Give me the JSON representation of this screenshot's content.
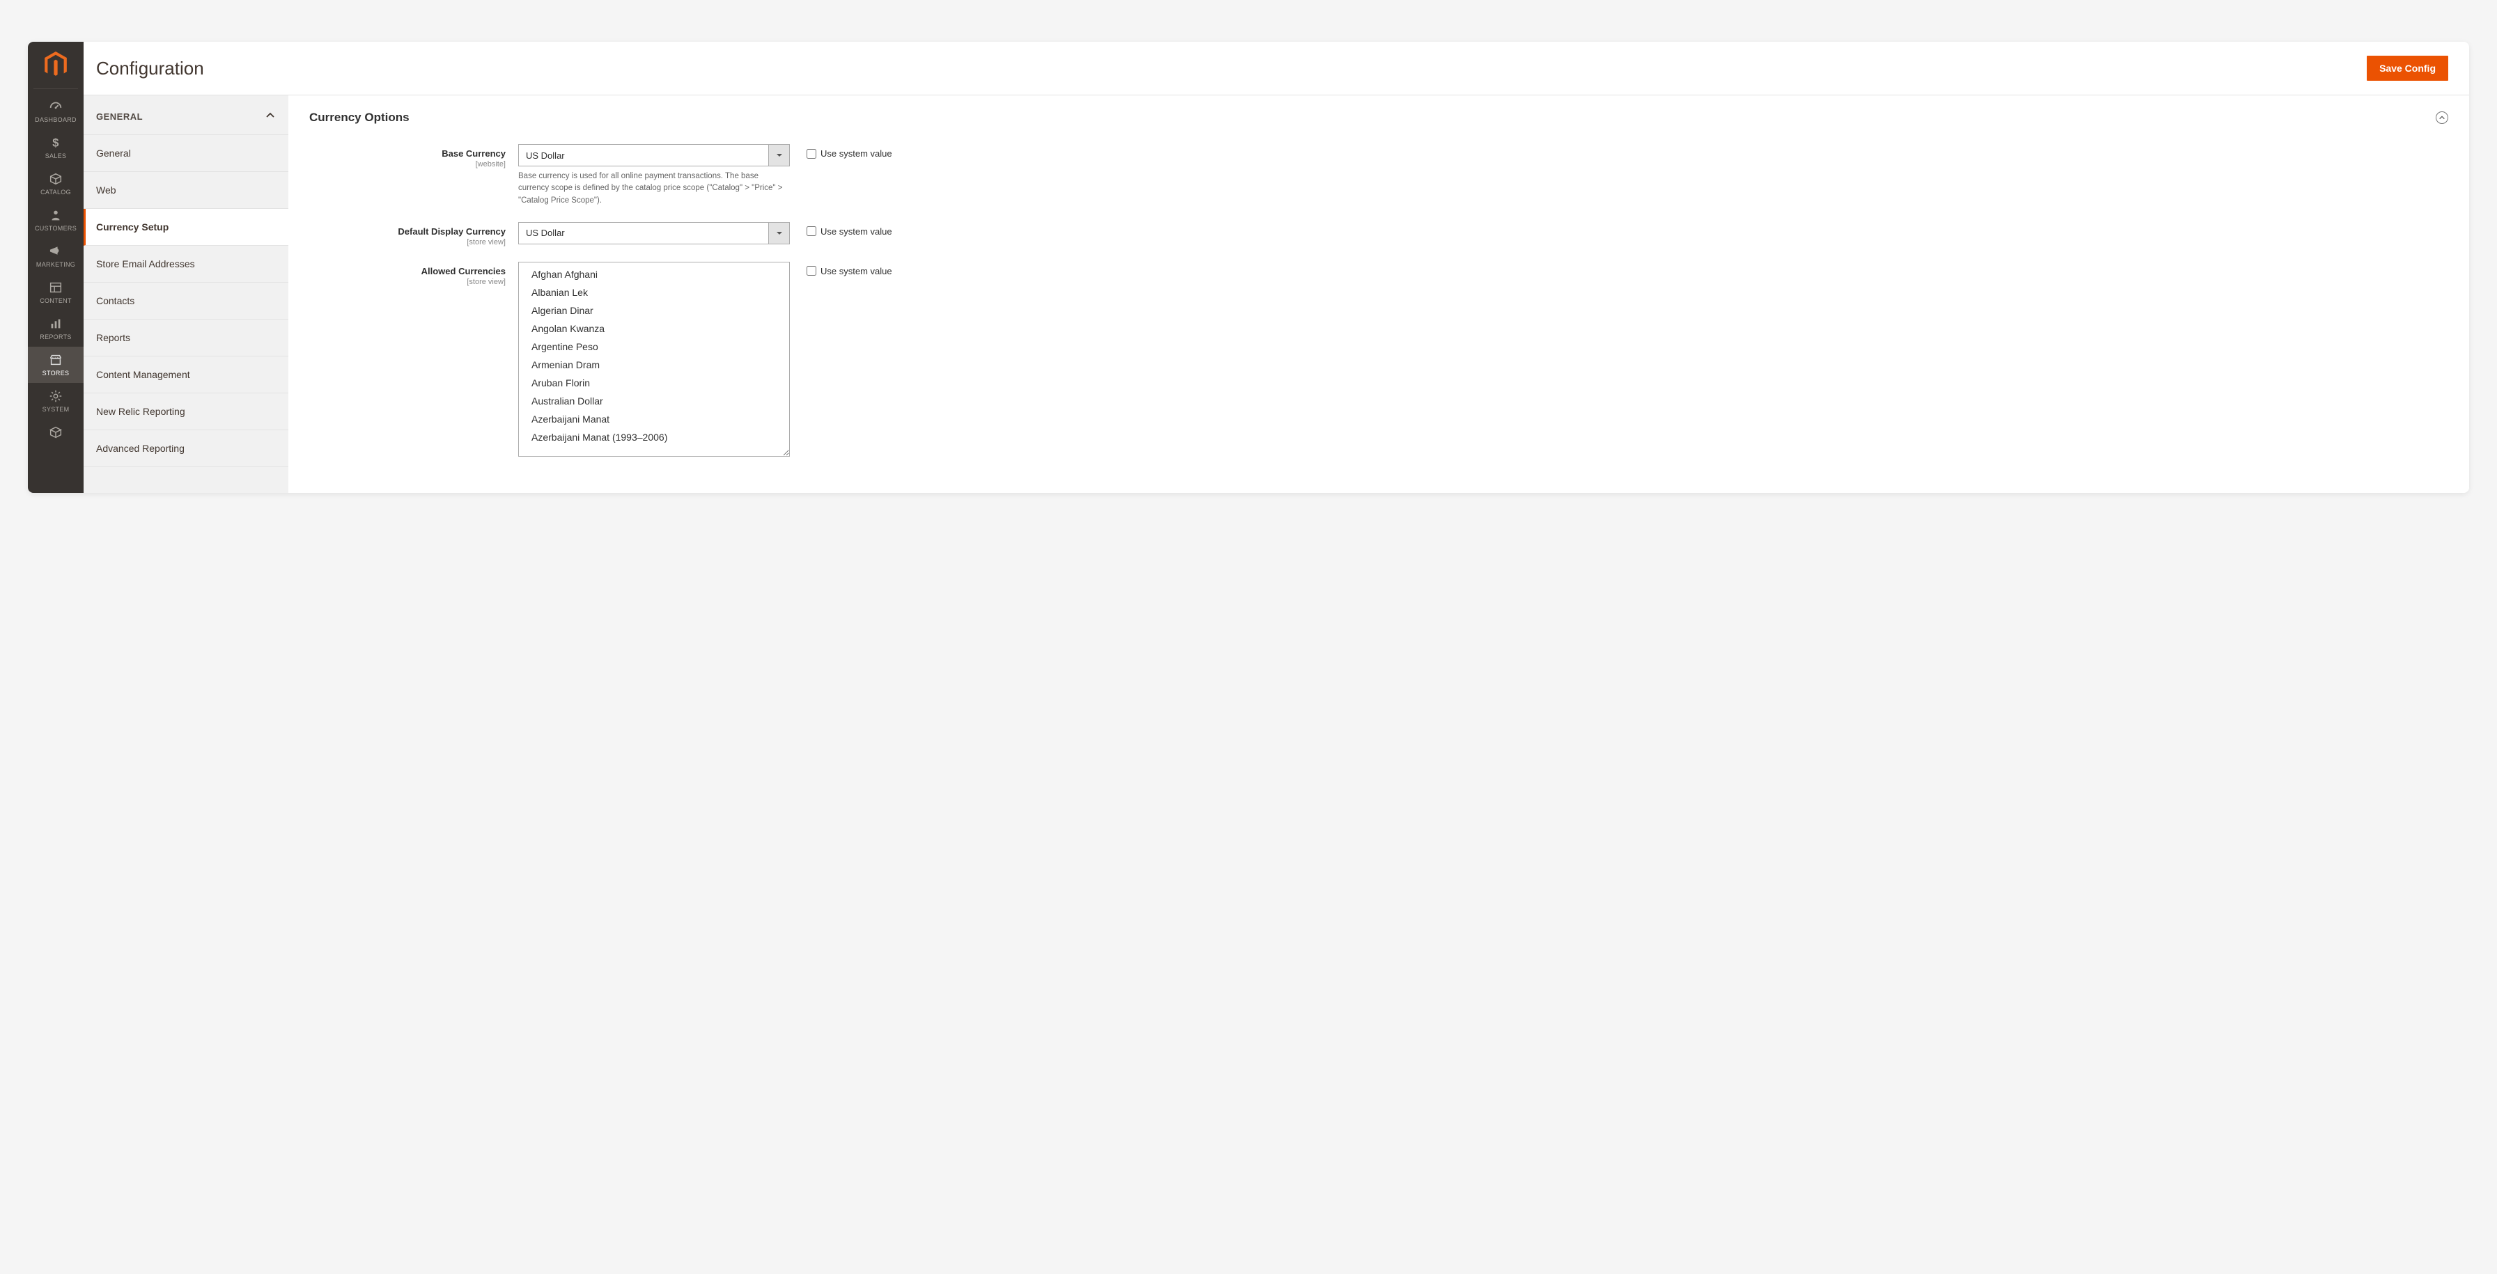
{
  "header": {
    "title": "Configuration",
    "save_button": "Save Config"
  },
  "nav": {
    "items": [
      {
        "id": "dashboard",
        "label": "DASHBOARD",
        "icon": "dashboard"
      },
      {
        "id": "sales",
        "label": "SALES",
        "icon": "dollar"
      },
      {
        "id": "catalog",
        "label": "CATALOG",
        "icon": "box"
      },
      {
        "id": "customers",
        "label": "CUSTOMERS",
        "icon": "person"
      },
      {
        "id": "marketing",
        "label": "MARKETING",
        "icon": "megaphone"
      },
      {
        "id": "content",
        "label": "CONTENT",
        "icon": "layout"
      },
      {
        "id": "reports",
        "label": "REPORTS",
        "icon": "bars"
      },
      {
        "id": "stores",
        "label": "STORES",
        "icon": "storefront",
        "active": true
      },
      {
        "id": "system",
        "label": "SYSTEM",
        "icon": "gear"
      },
      {
        "id": "find",
        "label": "",
        "icon": "cube"
      }
    ]
  },
  "config_tabs": {
    "group_label": "GENERAL",
    "items": [
      {
        "label": "General"
      },
      {
        "label": "Web"
      },
      {
        "label": "Currency Setup",
        "active": true
      },
      {
        "label": "Store Email Addresses"
      },
      {
        "label": "Contacts"
      },
      {
        "label": "Reports"
      },
      {
        "label": "Content Management"
      },
      {
        "label": "New Relic Reporting"
      },
      {
        "label": "Advanced Reporting"
      }
    ]
  },
  "section": {
    "title": "Currency Options"
  },
  "fields": {
    "base_currency": {
      "label": "Base Currency",
      "scope": "[website]",
      "value": "US Dollar",
      "note": "Base currency is used for all online payment transactions. The base currency scope is defined by the catalog price scope (\"Catalog\" > \"Price\" > \"Catalog Price Scope\").",
      "use_system_label": "Use system value"
    },
    "default_display": {
      "label": "Default Display Currency",
      "scope": "[store view]",
      "value": "US Dollar",
      "use_system_label": "Use system value"
    },
    "allowed": {
      "label": "Allowed Currencies",
      "scope": "[store view]",
      "use_system_label": "Use system value",
      "options": [
        "Afghan Afghani",
        "Albanian Lek",
        "Algerian Dinar",
        "Angolan Kwanza",
        "Argentine Peso",
        "Armenian Dram",
        "Aruban Florin",
        "Australian Dollar",
        "Azerbaijani Manat",
        "Azerbaijani Manat (1993–2006)"
      ]
    }
  },
  "colors": {
    "accent": "#eb5202",
    "nav_bg": "#373330",
    "nav_active": "#524d49"
  }
}
